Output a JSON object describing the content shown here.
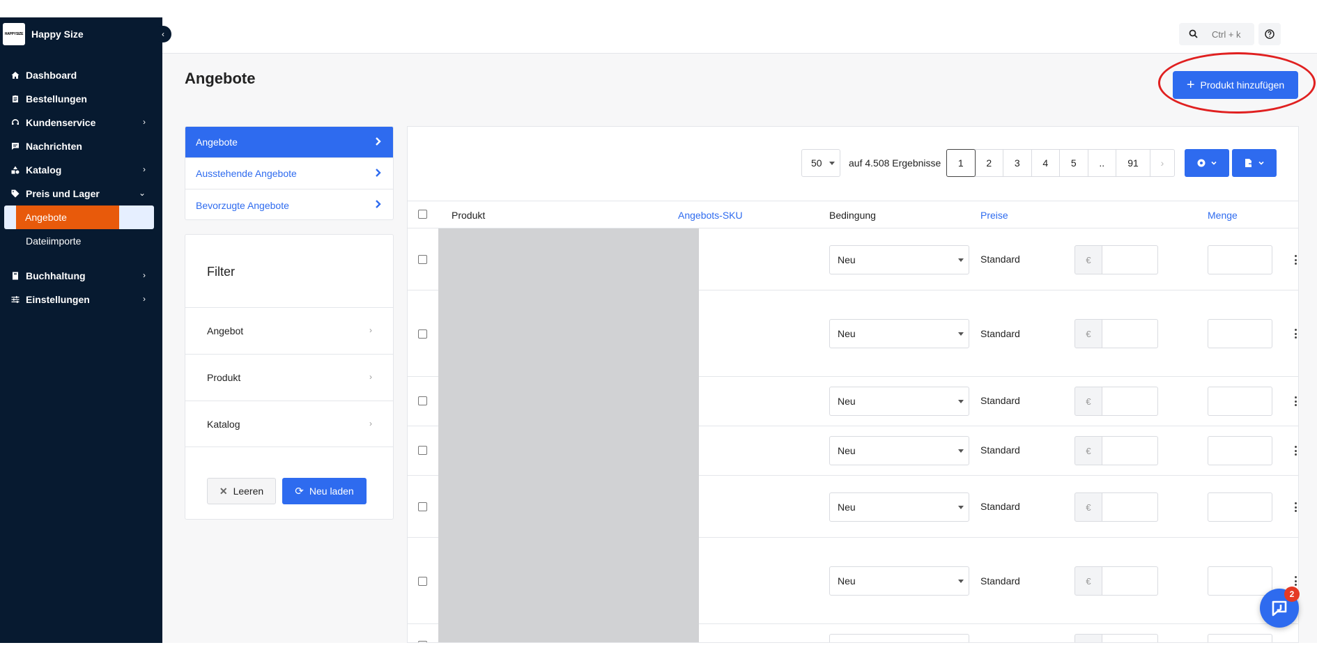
{
  "brand": {
    "logo_text": "HAPPYSIZE",
    "name": "Happy Size"
  },
  "sidebar": {
    "collapse_icon": "chevron-left-icon",
    "items": [
      {
        "label": "Dashboard",
        "icon": "home-icon",
        "has_children": false
      },
      {
        "label": "Bestellungen",
        "icon": "clipboard-icon",
        "has_children": false
      },
      {
        "label": "Kundenservice",
        "icon": "headset-icon",
        "has_children": true
      },
      {
        "label": "Nachrichten",
        "icon": "message-icon",
        "has_children": false
      },
      {
        "label": "Katalog",
        "icon": "shapes-icon",
        "has_children": true
      },
      {
        "label": "Preis und Lager",
        "icon": "tag-icon",
        "has_children": true,
        "expanded": true
      },
      {
        "label": "Buchhaltung",
        "icon": "book-icon",
        "has_children": true
      },
      {
        "label": "Einstellungen",
        "icon": "sliders-icon",
        "has_children": true
      }
    ],
    "subitems": [
      {
        "label": "Angebote",
        "active": true
      },
      {
        "label": "Dateiimporte",
        "active": false
      }
    ]
  },
  "topbar": {
    "search_placeholder": "Ctrl + k",
    "search_icon": "search-icon",
    "help_icon": "question-circle-icon"
  },
  "page": {
    "title": "Angebote",
    "add_button_label": "Produkt hinzufügen"
  },
  "tabs": [
    {
      "label": "Angebote",
      "active": true
    },
    {
      "label": "Ausstehende Angebote",
      "active": false
    },
    {
      "label": "Bevorzugte Angebote",
      "active": false
    }
  ],
  "filter": {
    "title": "Filter",
    "rows": [
      "Angebot",
      "Produkt",
      "Katalog"
    ],
    "clear_label": "Leeren",
    "reload_label": "Neu laden"
  },
  "toolbar": {
    "page_size": "50",
    "results_text": "auf 4.508 Ergebnisse",
    "pages": [
      "1",
      "2",
      "3",
      "4",
      "5",
      "..",
      "91"
    ],
    "current_page": "1",
    "next_label": "›"
  },
  "table": {
    "columns": [
      "Produkt",
      "Angebots-SKU",
      "Bedingung",
      "Preise",
      "Menge"
    ],
    "rows": [
      {
        "condition": "Neu",
        "price_type": "Standard",
        "currency": "€"
      },
      {
        "condition": "Neu",
        "price_type": "Standard",
        "currency": "€"
      },
      {
        "condition": "Neu",
        "price_type": "Standard",
        "currency": "€"
      },
      {
        "condition": "Neu",
        "price_type": "Standard",
        "currency": "€"
      },
      {
        "condition": "Neu",
        "price_type": "Standard",
        "currency": "€"
      },
      {
        "condition": "Neu",
        "price_type": "Standard",
        "currency": "€"
      }
    ]
  },
  "help_widget": {
    "badge": "2"
  },
  "colors": {
    "sidebar_bg": "#071a30",
    "accent": "#2e6bef",
    "active_item": "#e85a0b",
    "annotation": "#e02020"
  }
}
